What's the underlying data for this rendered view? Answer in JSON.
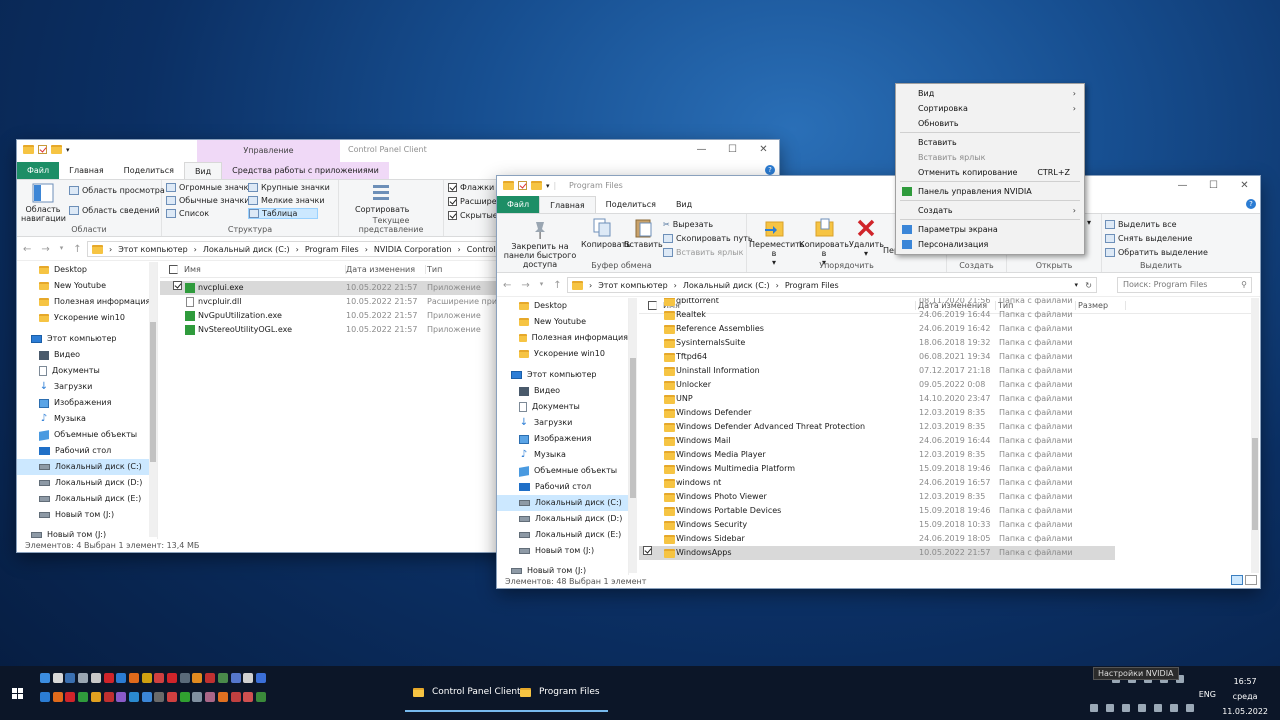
{
  "win1": {
    "title": "Control Panel Client",
    "context_tab": "Управление",
    "tabs": [
      "Файл",
      "Главная",
      "Поделиться",
      "Вид"
    ],
    "context_subtab": "Средства работы с приложениями",
    "ribbon": {
      "nav_pane": "Область навигации",
      "preview_pane": "Область просмотра",
      "details_pane": "Область сведений",
      "group_areas": "Области",
      "layout_items": [
        "Огромные значки",
        "Крупные значки",
        "Обычные значки",
        "Мелкие значки",
        "Список",
        "Таблица"
      ],
      "group_layout": "Структура",
      "sort": "Сортировать",
      "group_view": "Текущее представление",
      "checks": [
        "Флажки эле",
        "Расширени",
        "Скрытые эл"
      ]
    },
    "breadcrumb": [
      "Этот компьютер",
      "Локальный диск (C:)",
      "Program Files",
      "NVIDIA Corporation",
      "Control Panel Clien"
    ],
    "nav": [
      "Desktop",
      "New Youtube",
      "Полезная информация",
      "Ускорение win10",
      "Этот компьютер",
      "Видео",
      "Документы",
      "Загрузки",
      "Изображения",
      "Музыка",
      "Объемные объекты",
      "Рабочий стол",
      "Локальный диск (C:)",
      "Локальный диск (D:)",
      "Локальный диск (E:)",
      "Новый том (J:)",
      "Новый том (J:)"
    ],
    "columns": [
      "Имя",
      "Дата изменения",
      "Тип"
    ],
    "files": [
      {
        "name": "nvcplui.exe",
        "date": "10.05.2022 21:57",
        "type": "Приложение"
      },
      {
        "name": "nvcpluir.dll",
        "date": "10.05.2022 21:57",
        "type": "Расширение при..."
      },
      {
        "name": "NvGpuUtilization.exe",
        "date": "10.05.2022 21:57",
        "type": "Приложение"
      },
      {
        "name": "NvStereoUtilityOGL.exe",
        "date": "10.05.2022 21:57",
        "type": "Приложение"
      }
    ],
    "status": "Элементов: 4     Выбран 1 элемент: 13,4 МБ"
  },
  "win2": {
    "title": "Program Files",
    "tabs": [
      "Файл",
      "Главная",
      "Поделиться",
      "Вид"
    ],
    "ribbon": {
      "pin": "Закрепить на панели быстрого доступа",
      "copy": "Копировать",
      "paste": "Вставить",
      "cut": "Вырезать",
      "copy_path": "Скопировать путь",
      "paste_shortcut": "Вставить ярлык",
      "group_clipboard": "Буфер обмена",
      "move": "Переместить в",
      "copy_to": "Копировать в",
      "delete": "Удалить",
      "rename": "Пере",
      "group_organize": "Упорядочить",
      "group_create": "Создать",
      "group_open": "Открыть",
      "select_all": "Выделить все",
      "select_none": "Снять выделение",
      "invert": "Обратить выделение",
      "group_select": "Выделить"
    },
    "breadcrumb": [
      "Этот компьютер",
      "Локальный диск (C:)",
      "Program Files"
    ],
    "search_placeholder": "Поиск: Program Files",
    "nav": [
      "Desktop",
      "New Youtube",
      "Полезная информация",
      "Ускорение win10",
      "Этот компьютер",
      "Видео",
      "Документы",
      "Загрузки",
      "Изображения",
      "Музыка",
      "Объемные объекты",
      "Рабочий стол",
      "Локальный диск (C:)",
      "Локальный диск (D:)",
      "Локальный диск (E:)",
      "Новый том (J:)",
      "Новый том (J:)"
    ],
    "columns": [
      "Имя",
      "Дата изменения",
      "Тип",
      "Размер"
    ],
    "files": [
      {
        "name": "qbittorrent",
        "date": "08.11.2020 21:56",
        "type": "Папка с файлами"
      },
      {
        "name": "Realtek",
        "date": "24.06.2019 16:44",
        "type": "Папка с файлами"
      },
      {
        "name": "Reference Assemblies",
        "date": "24.06.2019 16:42",
        "type": "Папка с файлами"
      },
      {
        "name": "SysinternalsSuite",
        "date": "18.06.2018 19:32",
        "type": "Папка с файлами"
      },
      {
        "name": "Tftpd64",
        "date": "06.08.2021 19:34",
        "type": "Папка с файлами"
      },
      {
        "name": "Uninstall Information",
        "date": "07.12.2017 21:18",
        "type": "Папка с файлами"
      },
      {
        "name": "Unlocker",
        "date": "09.05.2022 0:08",
        "type": "Папка с файлами"
      },
      {
        "name": "UNP",
        "date": "14.10.2020 23:47",
        "type": "Папка с файлами"
      },
      {
        "name": "Windows Defender",
        "date": "12.03.2019 8:35",
        "type": "Папка с файлами"
      },
      {
        "name": "Windows Defender Advanced Threat Protection",
        "date": "12.03.2019 8:35",
        "type": "Папка с файлами"
      },
      {
        "name": "Windows Mail",
        "date": "24.06.2019 16:44",
        "type": "Папка с файлами"
      },
      {
        "name": "Windows Media Player",
        "date": "12.03.2019 8:35",
        "type": "Папка с файлами"
      },
      {
        "name": "Windows Multimedia Platform",
        "date": "15.09.2018 19:46",
        "type": "Папка с файлами"
      },
      {
        "name": "windows nt",
        "date": "24.06.2019 16:57",
        "type": "Папка с файлами"
      },
      {
        "name": "Windows Photo Viewer",
        "date": "12.03.2019 8:35",
        "type": "Папка с файлами"
      },
      {
        "name": "Windows Portable Devices",
        "date": "15.09.2018 19:46",
        "type": "Папка с файлами"
      },
      {
        "name": "Windows Security",
        "date": "15.09.2018 10:33",
        "type": "Папка с файлами"
      },
      {
        "name": "Windows Sidebar",
        "date": "24.06.2019 18:05",
        "type": "Папка с файлами"
      },
      {
        "name": "WindowsApps",
        "date": "10.05.2022 21:57",
        "type": "Папка с файлами"
      }
    ],
    "status": "Элементов: 48     Выбран 1 элемент"
  },
  "context_menu": {
    "view": "Вид",
    "sort": "Сортировка",
    "refresh": "Обновить",
    "paste": "Вставить",
    "paste_shortcut": "Вставить ярлык",
    "undo": "Отменить копирование",
    "undo_shortcut": "CTRL+Z",
    "nvidia": "Панель управления NVIDIA",
    "create": "Создать",
    "display": "Параметры экрана",
    "personalize": "Персонализация"
  },
  "taskbar": {
    "tasks": [
      "Control Panel Client",
      "Program Files"
    ],
    "tooltip": "Настройки NVIDIA",
    "lang": "ENG",
    "time": "16:57",
    "day": "среда",
    "date": "11.05.2022"
  },
  "colors": {
    "file_tab": "#1d8e66",
    "context_tab": "#f0d9f7",
    "selection": "#cce8ff"
  }
}
